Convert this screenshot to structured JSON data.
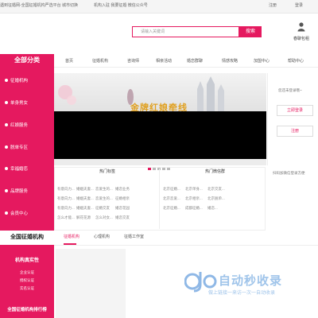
{
  "topbar": {
    "left_text": "遇到征婚网-全国征婚机构严选平台  城市切换",
    "mid_text": "机构入驻  我要征婚  微信公众号",
    "register": "注册",
    "login": "登录"
  },
  "search": {
    "placeholder": "请输入关键词",
    "button": "搜索"
  },
  "user": {
    "label": "春聊包租"
  },
  "sidebar": {
    "title": "全部分类",
    "items": [
      {
        "label": "征婚机构"
      },
      {
        "label": "单身男女"
      },
      {
        "label": "红娘服务"
      },
      {
        "label": "脱单专区"
      },
      {
        "label": "幸福婚恋"
      },
      {
        "label": "品牌服务"
      },
      {
        "label": "会员中心"
      }
    ]
  },
  "nav": {
    "items": [
      "首页",
      "征婚机构",
      "咨询师",
      "相亲活动",
      "婚恋群聊",
      "情感攻略",
      "加盟中心",
      "帮助中心"
    ]
  },
  "banner": {
    "text": "金牌红娘牵线"
  },
  "right_panel": {
    "welcome": "您还未登录哦~",
    "login_button": "立即登录",
    "register_button": "注册",
    "note": "扫码加微信登录方便"
  },
  "tags": {
    "hot_tags_title": "热门标签",
    "hot_groups_title": "热门微信群",
    "tag_rows": [
      [
        "有意向力...",
        "婚姻夫妻...",
        "恋爱生的...",
        "婚恋业务"
      ],
      [
        "有意向力...",
        "婚姻夫妻...",
        "恋爱生的...",
        "征婚相亲"
      ],
      [
        "有意向力...",
        "婚姻夫妻...",
        "征婚交友",
        "婚恋花园"
      ],
      [
        "怎么才能...",
        "解花花源",
        "怎么对女...",
        "婚恋交友"
      ]
    ],
    "group_rows": [
      [
        "北京征婚...",
        "北京单身...",
        "北京交友..."
      ],
      [
        "北京恋爱...",
        "北京相亲...",
        "北京脱单..."
      ],
      [
        "北京征婚...",
        "成都征婚...",
        "婚恋..."
      ]
    ]
  },
  "bottom": {
    "section_title": "全国征婚机构",
    "tabs": [
      "征婚机构",
      "心理机构",
      "征婚工作室"
    ],
    "pink_heading1": "机构真实性",
    "pink_subs": [
      "企业认证",
      "授权认证",
      "实名认证"
    ],
    "pink_heading2": "全国征婚机构排行榜"
  },
  "watermark": {
    "title": "自动秒收录",
    "subtitle": "做上链接一来访一次一自动收录"
  },
  "colors": {
    "accent": "#e5195f"
  }
}
